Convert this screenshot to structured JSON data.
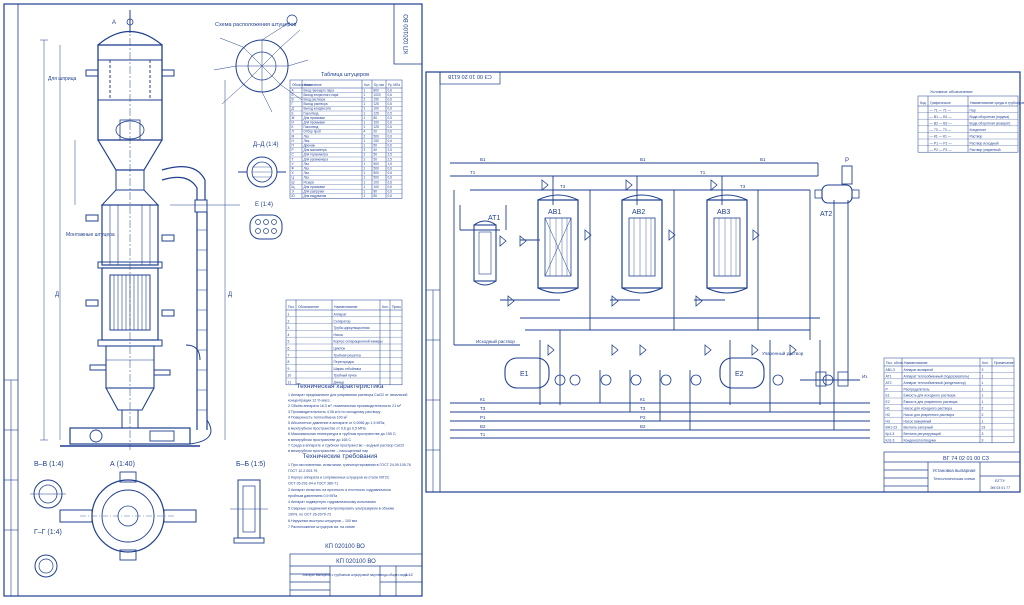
{
  "colors": {
    "ink": "#1f3f8f",
    "ink_light": "#3b66c9",
    "paper": "#ffffff"
  },
  "sheet_left": {
    "code_top": "КП 020100 ВО",
    "view_dd": "Д–Д (1:4)",
    "view_e": "Е (1:4)",
    "view_vv": "В–В (1:4)",
    "view_gg": "Г–Г (1:4)",
    "view_a": "А (1:40)",
    "view_bb": "Б–Б (1:5)",
    "labels": {
      "schema_title": "Схема расположения штуцеров",
      "shtuc_table_title": "Таблица штуцеров",
      "tech_title": "Техническая характеристика",
      "req_title": "Технические требования",
      "code_bottom": "КП 020100 ВО",
      "stamp_title": "Аппарат Выпарной с трубчатым штуцеровой нагрев вида общего вида",
      "pouring": "Для шприца",
      "platform": "Монтажные штуцера",
      "stamp_sheet": "1:42"
    },
    "shtuc_headers": [
      "Обозначение",
      "Назначение",
      "Кол.",
      "Dy, мм",
      "Py, МПа"
    ],
    "shtuc_rows": [
      [
        "А",
        "Вход греющего пара",
        "1",
        "800",
        "0,6"
      ],
      [
        "Б",
        "Выход вторичного пара",
        "1",
        "1000",
        "0,6"
      ],
      [
        "В",
        "Вход раствора",
        "2",
        "150",
        "0,6"
      ],
      [
        "Г",
        "Выход раствора",
        "1",
        "125",
        "0,6"
      ],
      [
        "Д",
        "Выход конденсата",
        "1",
        "100",
        "0,6"
      ],
      [
        "Е",
        "Газоотвод",
        "1",
        "125",
        "0,5"
      ],
      [
        "Ж",
        "Для промывки",
        "1",
        "80",
        "0,5"
      ],
      [
        "И",
        "Для промывки",
        "1",
        "100",
        "0,6"
      ],
      [
        "К",
        "Газоотвод",
        "1",
        "125",
        "0,6"
      ],
      [
        "Л",
        "Отбор проб",
        "4",
        "20",
        "0,6"
      ],
      [
        "М",
        "Лаз",
        "2",
        "500",
        "0,6"
      ],
      [
        "Н",
        "Люк",
        "1",
        "150",
        "0,6"
      ],
      [
        "П",
        "Дренаж",
        "1",
        "50",
        "0,6"
      ],
      [
        "Р",
        "Для манометра",
        "3",
        "40",
        "2,5"
      ],
      [
        "С",
        "Для термометра",
        "2",
        "50",
        "2,5"
      ],
      [
        "Т",
        "Для уровнемера",
        "2",
        "50",
        "2,5"
      ],
      [
        "У",
        "Лаз",
        "1",
        "500",
        "1,5"
      ],
      [
        "Ф",
        "Лаз",
        "1",
        "500",
        "0,6"
      ],
      [
        "Х",
        "Лаз",
        "1",
        "500",
        "0,6"
      ],
      [
        "Ц",
        "Лаз",
        "1",
        "500",
        "0,6"
      ],
      [
        "Ш",
        "Резерв",
        "1",
        "100",
        "0,6"
      ],
      [
        "Щ",
        "Для промывки",
        "1",
        "100",
        "0,6"
      ],
      [
        "Э",
        "Для разгрузки",
        "1",
        "80",
        "0,6"
      ],
      [
        "Ю",
        "Для выдувания",
        "1",
        "80",
        "0,6"
      ]
    ],
    "spec_headers": [
      "Поз.",
      "Обозначение",
      "Наименование",
      "Кол.",
      "Прим."
    ],
    "spec_rows": [
      [
        "1",
        "",
        "Аппарат"
      ],
      [
        "2",
        "",
        "Сепаратор"
      ],
      [
        "3",
        "",
        "Труба циркуляционная"
      ],
      [
        "4",
        "",
        "Насос"
      ],
      [
        "5",
        "",
        "Корпус сепарационной камеры"
      ],
      [
        "6",
        "",
        "Циклон"
      ],
      [
        "7",
        "",
        "Трубная решетка"
      ],
      [
        "8",
        "",
        "Перегородка"
      ],
      [
        "9",
        "",
        "Шарик отбойника"
      ],
      [
        "10",
        "",
        "Трубный пучок"
      ],
      [
        "11",
        "",
        "Днище"
      ]
    ],
    "tech_lines": [
      "1 Аппарат предназначен для упаривания раствора CaCl2 от начальной",
      "   концентрации 12 % масс.",
      "2 Объём аппарата 16,3 м³, номинальная производительность 21 м³",
      "3 Производительность 4,06 кг/с по исходному раствору",
      "4 Поверхность теплообмена 100 м²",
      "5 Абсолютное давление в аппарате от 0,0056 до 1,5 МПа;",
      "   в межтрубном пространстве от 0,6 до 0,5 МПа",
      "6 Максимальная температура в трубном пространстве до 155 С;",
      "   в межтрубном пространстве до 165 С",
      "7 Среда в аппарате и трубном пространстве – водный раствор CaCl2",
      "   в межтрубном пространстве – насыщенный пар"
    ],
    "req_lines": [
      "1 При изготовлении, испытании, транспортировании в ГОСТ 24.09.105.76",
      "   ГОСТ 12.2.003.79.",
      "2 Корпус аппарата и сопряженных штуцеров из стали 09Г2С",
      "   ОСТ 26-291-94 и ГОСТ 380-71",
      "3 Аппарат испытать на прочность и плотность гидравлически",
      "   пробным давлением 0,9 МПа",
      "4 Аппарат подвергнуть гидравлическому испытанию",
      "5 Сварные соединения контролировать ультразвуком в объеме",
      "   100%, по ОСТ 26-2079-73",
      "6 Наружные выступы штуцеров – 100 мм",
      "7 Расположение штуцеров см. на схеме"
    ],
    "stamp_code": "КП 020100 ВО"
  },
  "sheet_right": {
    "code_top": "СЗ 00 10 20 6118",
    "units": [
      "АВ1",
      "АВ2",
      "АВ3",
      "АТ1",
      "АТ2",
      "Е1",
      "Е2",
      "Р"
    ],
    "legend_title": "Условное обозначение",
    "legend_headers": [
      "Код",
      "Графическое",
      "Наименование среды в трубопроводе"
    ],
    "legend_rows": [
      [
        "",
        "— 71 — 71 —",
        "Пар"
      ],
      [
        "",
        "— В1 — В1 —",
        "Вода оборотная (подача)"
      ],
      [
        "",
        "— В2 — В2 —",
        "Вода оборотная (возврат)"
      ],
      [
        "",
        "— 73 — 73 —",
        "Конденсат"
      ],
      [
        "",
        "— К1 — К1 —",
        "Раствор"
      ],
      [
        "",
        "— Р1 — Р1 —",
        "Раствор исходный"
      ],
      [
        "",
        "— Р2 — Р2 —",
        "Раствор упаренный"
      ]
    ],
    "equip_headers": [
      "Поз. обозн.",
      "Наименование",
      "Кол.",
      "Примечание"
    ],
    "equip_rows": [
      [
        "АВ1-3",
        "Аппарат выпарной",
        "3",
        ""
      ],
      [
        "АТ1",
        "Аппарат теплообменный (подогреватель)",
        "1",
        ""
      ],
      [
        "АТ2",
        "Аппарат теплообменный (конденсатор)",
        "1",
        ""
      ],
      [
        "Р",
        "Распределитель",
        "1",
        ""
      ],
      [
        "Е1",
        "Ёмкость для исходного раствора",
        "1",
        ""
      ],
      [
        "Е2",
        "Ёмкость для упаренного раствора",
        "1",
        ""
      ],
      [
        "Н1",
        "Насос для исходного раствора",
        "2",
        ""
      ],
      [
        "Н2",
        "Насос для упаренного раствора",
        "2",
        ""
      ],
      [
        "Н3",
        "Насос вакуумный",
        "1",
        ""
      ],
      [
        "ВН1-23",
        "Вентиль запорный",
        "23",
        ""
      ],
      [
        "Кр1-3",
        "Вентиль регулирующий",
        "3",
        ""
      ],
      [
        "Кл1-3",
        "Конденсатоотводчик",
        "3",
        ""
      ]
    ],
    "stamp_code": "ВГ 74 02 01 00 СЗ",
    "stamp_title": "Установка выпарная",
    "stamp_subtitle": "Технологическая схема",
    "stamp_org": "БГТУ",
    "stamp_group": "ЭМ 03 01 77",
    "label_initial": "Исходный раствор",
    "label_product": "Упаренный раствор",
    "label_drain": "Из"
  }
}
